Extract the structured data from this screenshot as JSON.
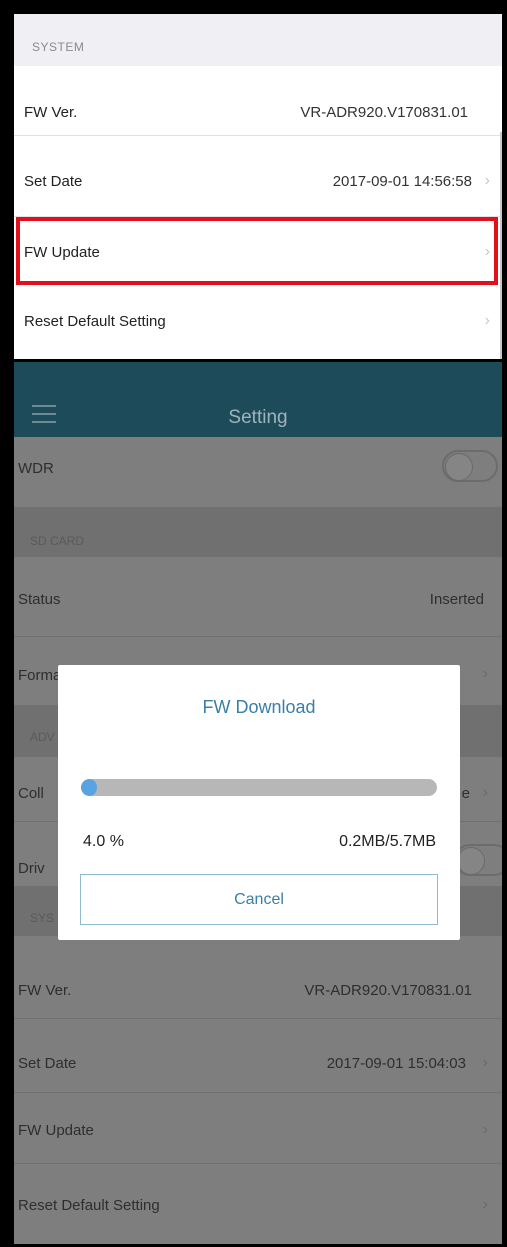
{
  "top_panel": {
    "section_label": "SYSTEM",
    "rows": [
      {
        "label": "FW Ver.",
        "value": "VR-ADR920.V170831.01",
        "chevron": ""
      },
      {
        "label": "Set Date",
        "value": "2017-09-01 14:56:58",
        "chevron": "›"
      },
      {
        "label": "FW Update",
        "value": "",
        "chevron": "›"
      },
      {
        "label": "Reset Default Setting",
        "value": "",
        "chevron": "›"
      }
    ]
  },
  "nav": {
    "title": "Setting",
    "menu_icon": "hamburger-menu-icon"
  },
  "settings": {
    "wdr": {
      "label": "WDR",
      "toggle_on": false
    },
    "sd_card_section": "SD CARD",
    "status": {
      "label": "Status",
      "value": "Inserted"
    },
    "format": {
      "label": "Format",
      "chevron": "›"
    },
    "adv_section": "ADV",
    "collision": {
      "label": "Coll",
      "value": "e",
      "chevron": "›"
    },
    "drive": {
      "label": "Driv"
    },
    "sys_section": "SYS",
    "fw_ver": {
      "label": "FW Ver.",
      "value": "VR-ADR920.V170831.01"
    },
    "set_date": {
      "label": "Set Date",
      "value": "2017-09-01 15:04:03",
      "chevron": "›"
    },
    "fw_update": {
      "label": "FW Update",
      "chevron": "›"
    },
    "reset": {
      "label": "Reset Default Setting",
      "chevron": "›"
    }
  },
  "dialog": {
    "title": "FW Download",
    "progress_percent": 4.0,
    "percent_text": "4.0 %",
    "size_text": "0.2MB/5.7MB",
    "cancel_label": "Cancel"
  },
  "colors": {
    "highlight": "#e3101c",
    "nav_bg": "#1d4b5a",
    "accent": "#3a7fa8",
    "progress_fill": "#5aa3e2"
  }
}
